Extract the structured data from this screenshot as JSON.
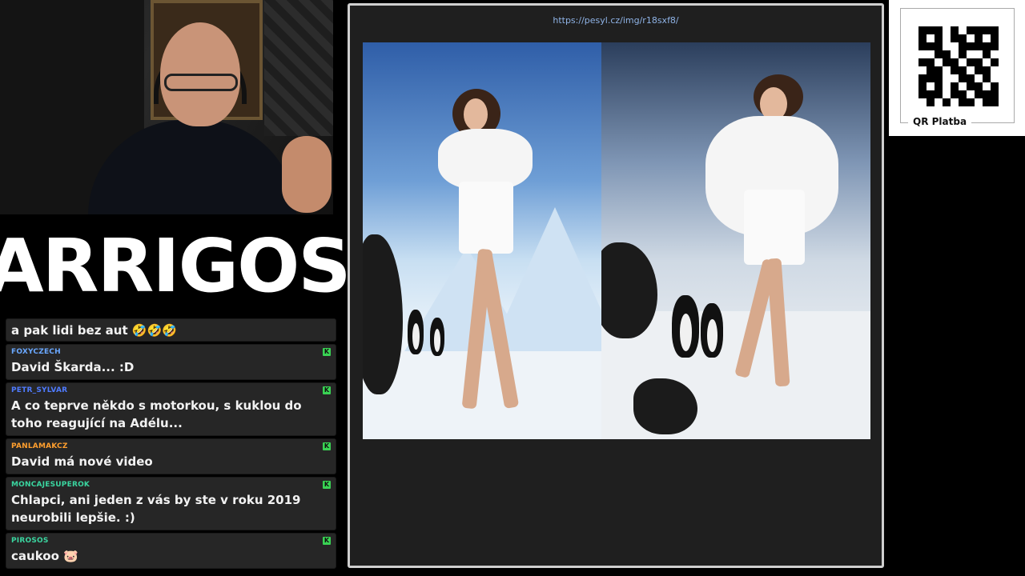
{
  "logo": {
    "text": "ARRIGOS"
  },
  "chat": {
    "messages": [
      {
        "user": "",
        "user_color": "#ffffff",
        "text": "a pak lidi bez aut 🤣🤣🤣",
        "badge": false
      },
      {
        "user": "FOXYCZECH",
        "user_color": "#6aa8ff",
        "text": "David Škarda... :D",
        "badge": true
      },
      {
        "user": "PETR_SYLVAR",
        "user_color": "#4f7bff",
        "text": "A co teprve někdo s motorkou, s kuklou do toho reagující na Adélu...",
        "badge": true
      },
      {
        "user": "PANLAMAKCZ",
        "user_color": "#ff9f2e",
        "text": "David má nové video",
        "badge": true
      },
      {
        "user": "MONCAJESUPEROK",
        "user_color": "#3ad6a0",
        "text": "Chlapci, ani jeden z vás by ste v roku 2019 neurobili lepšie. :)",
        "badge": true
      },
      {
        "user": "PIROSOS",
        "user_color": "#3ad6a0",
        "text": "caukoo 🐷",
        "badge": true
      }
    ],
    "badge_glyph": "K"
  },
  "browser": {
    "url": "https://pesyl.cz/img/r18sxf8/"
  },
  "qr": {
    "label": "QR Platba"
  }
}
